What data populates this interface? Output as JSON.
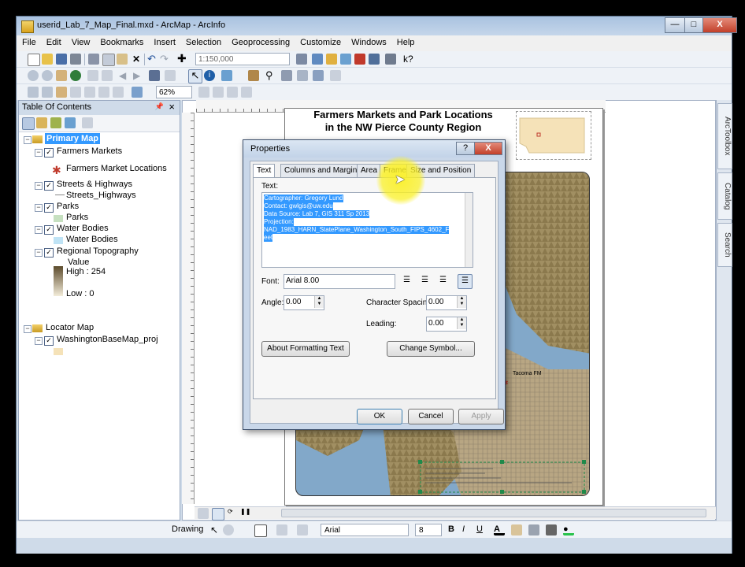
{
  "window": {
    "title": "userid_Lab_7_Map_Final.mxd - ArcMap - ArcInfo",
    "minimize": "—",
    "maximize": "□",
    "close": "X"
  },
  "menu": [
    "File",
    "Edit",
    "View",
    "Bookmarks",
    "Insert",
    "Selection",
    "Geoprocessing",
    "Customize",
    "Windows",
    "Help"
  ],
  "toolbar": {
    "scale": "1:150,000",
    "zoom": "62%"
  },
  "toc": {
    "title": "Table Of Contents",
    "pin": "📌",
    "close": "×",
    "frames": [
      {
        "name": "Primary Map",
        "layers": [
          {
            "name": "Farmers Markets",
            "legend": "Farmers Market Locations",
            "symbol": "bug"
          },
          {
            "name": "Streets & Highways",
            "legend": "Streets_Highways",
            "symbol": "line"
          },
          {
            "name": "Parks",
            "legend": "Parks",
            "symbol": "#c6e0c0"
          },
          {
            "name": "Water Bodies",
            "legend": "Water Bodies",
            "symbol": "#bfe3f5"
          },
          {
            "name": "Regional Topography",
            "legend": "Value",
            "high": "High : 254",
            "low": "Low : 0",
            "symbol": "ramp"
          }
        ]
      },
      {
        "name": "Locator Map",
        "layers": [
          {
            "name": "WashingtonBaseMap_proj",
            "symbol": "#f5e2b8"
          }
        ]
      }
    ]
  },
  "layout": {
    "map_title_1": "Farmers Markets and Park Locations",
    "map_title_2": "in the NW Pierce County Region",
    "map_label": "Tacoma FM"
  },
  "right_tabs": [
    "ArcToolbox",
    "Catalog",
    "Search"
  ],
  "drawing_bar": {
    "label": "Drawing",
    "font": "Arial",
    "size": "8"
  },
  "dialog": {
    "title": "Properties",
    "help": "?",
    "close": "X",
    "tabs": [
      "Text",
      "Columns and Margins",
      "Area",
      "Frame",
      "Size and Position"
    ],
    "text_label": "Text:",
    "text_lines": [
      "Cartographer: Gregory Lund",
      "Contact: gwlgis@uw.edu",
      "Data Source: Lab 7, GIS 311 Sp 2013",
      "Projection:",
      "NAD_1983_HARN_StatePlane_Washington_South_FIPS_4602_F",
      "eet"
    ],
    "font_label": "Font:",
    "font_value": "Arial 8.00",
    "angle_label": "Angle:",
    "angle_value": "0.00",
    "char_spacing_label": "Character Spacing:",
    "char_spacing_value": "0.00",
    "leading_label": "Leading:",
    "leading_value": "0.00",
    "about_button": "About Formatting Text",
    "symbol_button": "Change Symbol...",
    "ok": "OK",
    "cancel": "Cancel",
    "apply": "Apply"
  },
  "colors": {
    "highlight": "#3399ff",
    "cursor_glow": "#f5ee30",
    "title_bar": "#c2d3e8"
  }
}
